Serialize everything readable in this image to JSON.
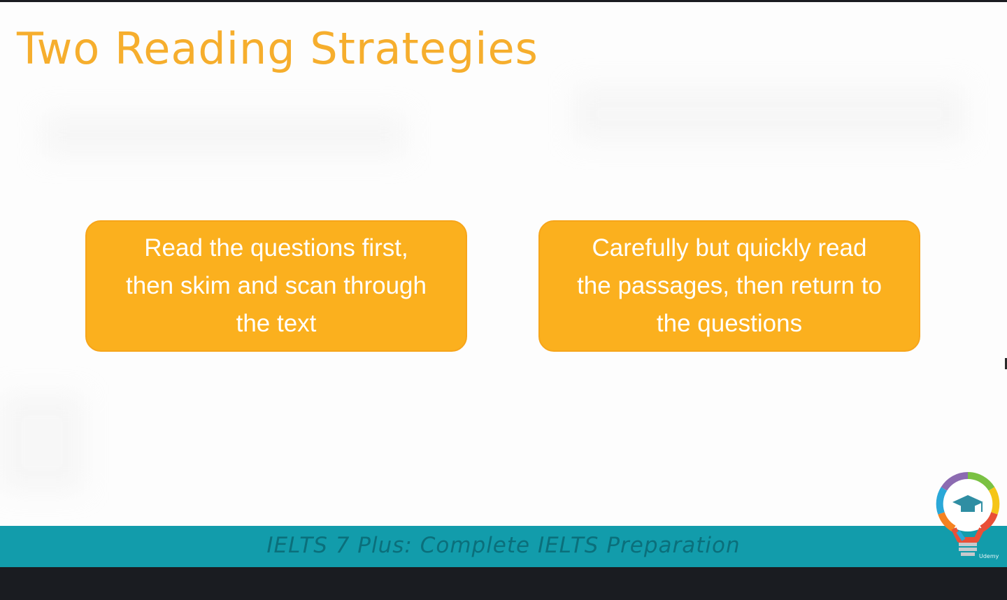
{
  "slide": {
    "title": "Two Reading Strategies",
    "strategies": [
      {
        "lines": [
          "Read the questions first,",
          "then skim and scan through",
          "the text"
        ]
      },
      {
        "lines": [
          "Carefully but quickly read",
          "the passages, then return to",
          "the questions"
        ]
      }
    ],
    "footer": "IELTS 7 Plus: Complete IELTS Preparation",
    "logo_caption": "Udemy"
  },
  "colors": {
    "title": "#f6ae2d",
    "box_fill": "#fbb01e",
    "footer_band": "#129cab",
    "footer_text": "#0b6f7b",
    "frame": "#1a1c21"
  },
  "icons": {
    "logo": "lightbulb-graduation-cap-icon"
  }
}
